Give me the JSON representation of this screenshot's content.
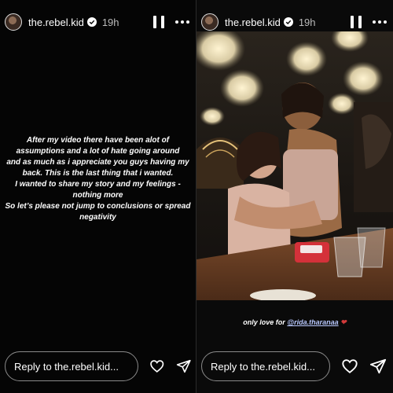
{
  "stories": [
    {
      "username": "the.rebel.kid",
      "time": "19h",
      "text_lines": [
        "After my video there have been alot of",
        "assumptions and a lot of hate going around",
        "and as much as i appreciate you guys having my",
        "back. This is the last thing that i wanted.",
        "I wanted to share my story and my feelings -",
        "nothing more",
        "So let’s please not jump to conclusions or spread",
        "negativity"
      ],
      "reply_placeholder": "Reply to the.rebel.kid..."
    },
    {
      "username": "the.rebel.kid",
      "time": "19h",
      "caption": "only love for",
      "mention": "@rida.tharanaa",
      "heart": "❤",
      "reply_placeholder": "Reply to the.rebel.kid..."
    }
  ],
  "icons": [
    "verified-badge-icon",
    "pause-icon",
    "more-icon",
    "heart-icon",
    "send-icon"
  ]
}
